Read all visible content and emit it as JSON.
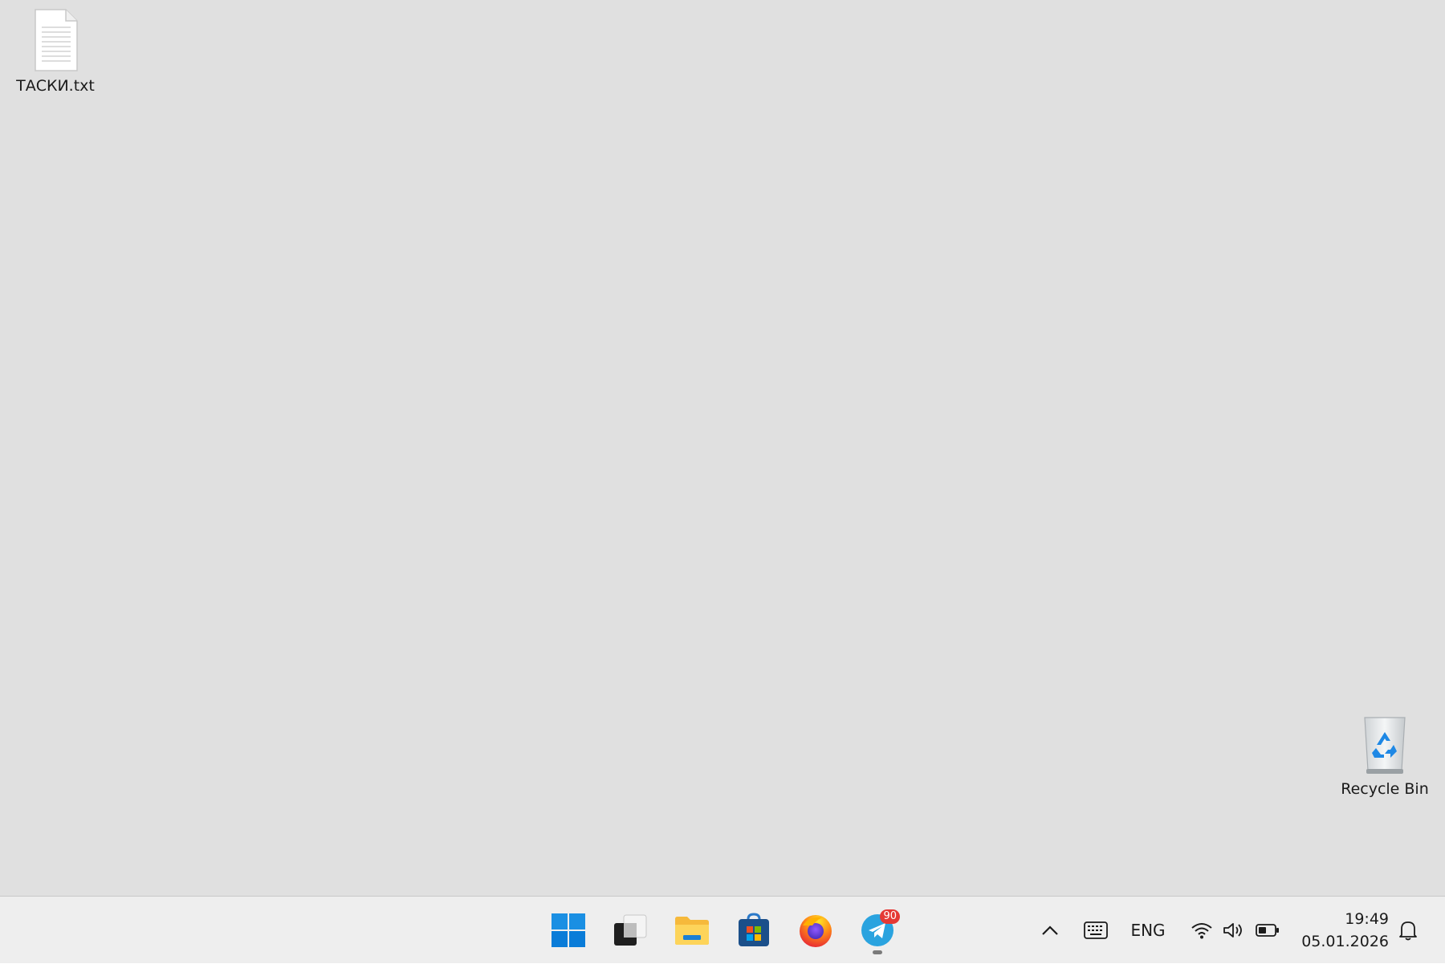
{
  "desktop": {
    "background": "#e0e0e0",
    "icons": [
      {
        "label": "ТАСКИ.txt",
        "icon": "text-file-icon"
      },
      {
        "label": "Recycle Bin",
        "icon": "recycle-bin-icon"
      }
    ]
  },
  "taskbar": {
    "background": "#eeeeee",
    "apps": [
      {
        "name": "Start",
        "icon": "windows-logo-icon"
      },
      {
        "name": "Task View",
        "icon": "task-view-icon"
      },
      {
        "name": "File Explorer",
        "icon": "folder-icon"
      },
      {
        "name": "Microsoft Store",
        "icon": "store-icon"
      },
      {
        "name": "Firefox",
        "icon": "firefox-icon"
      },
      {
        "name": "Telegram",
        "icon": "telegram-icon",
        "badge": "90",
        "running": true
      }
    ],
    "tray": {
      "chevron_icon": "chevron-up-icon",
      "keyboard_icon": "touch-keyboard-icon",
      "language": "ENG",
      "wifi_icon": "wifi-icon",
      "volume_icon": "speaker-icon",
      "battery_icon": "battery-icon",
      "time": "19:49",
      "date": "05.01.2026",
      "notification_icon": "bell-icon"
    }
  },
  "colors": {
    "accent_blue": "#0a7cd8",
    "badge_red": "#e53935",
    "telegram_blue": "#2aa3df"
  }
}
